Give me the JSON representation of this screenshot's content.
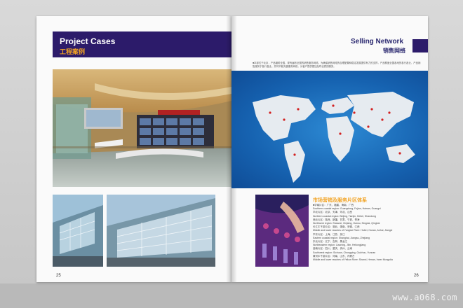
{
  "left_page": {
    "title_en": "Project Cases",
    "title_cn": "工程案例",
    "page_number": "25"
  },
  "right_page": {
    "title_en": "Selling Network",
    "title_cn": "销售网络",
    "intro": "■本部位于北京，产品辐射全国，现有遍布全国的销售服务网络，为确保销售网络的合理配置和稳定发展提供有力的支撑，产品覆盖全国各地的各行各业，产品销售服务于各行各业，并将不断完善服务网络，为客户提供更加及时优质的服务。",
    "service_title": "市场营销及服务片区体系",
    "service_lines": [
      "■华南片区：广东、福建、海南、广西",
      "Southern coastal region: Guangdong, Fujian, Hainan, Guangxi",
      "华北片区：北京、天津、河北、山西",
      "Northern coastal region: Beijing, Tianjin, Hebei, Shandong",
      "西北片区：陕西、新疆、甘肃、宁夏、青海",
      "Northwest region: Shaanxi, Xinjiang, Gansu, Ningxia, Qinghai",
      "长江中下游片区：湖北、湖南、安徽、江西",
      "Middle and lower reaches of Yangtze River: Hubei, Hunan, Anhui, Jiangxi",
      "华东片区：上海、江苏、浙江",
      "Eastern coastal region: Shanghai, Jiangsu, Zhejiang",
      "东北片区：辽宁、吉林、黑龙江",
      "Northeastern region: Liaoning, Jilin, Heilongjiang",
      "西南片区：四川、重庆、贵州、云南",
      "Southwest region: Sichuan, Chongqing, Guizhou, Yunnan",
      "黄河中下游片区：河南、山东、内蒙古",
      "Middle and lower reaches of Yellow River: Shanxi, Henan, Inner Mongolia"
    ],
    "page_number": "26"
  },
  "watermark": "www.a068.com",
  "colors": {
    "banner": "#2c1b6a",
    "accent_orange": "#f2a323",
    "map_blue": "#1662b0",
    "continent": "#e6ebf0",
    "marker_red": "#d32020"
  }
}
